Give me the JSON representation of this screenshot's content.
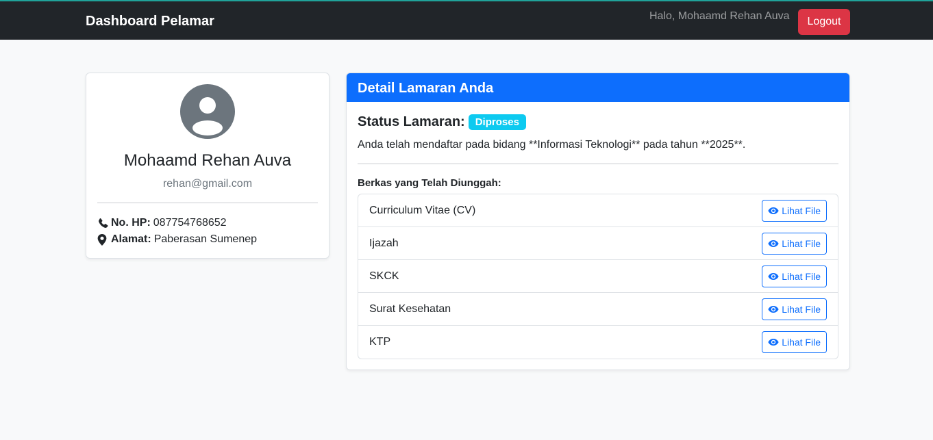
{
  "navbar": {
    "brand": "Dashboard Pelamar",
    "greeting": "Halo, Mohaamd Rehan Auva",
    "logout_label": "Logout"
  },
  "profile": {
    "avatar_icon": "user-circle-icon",
    "name": "Mohaamd Rehan Auva",
    "email": "rehan@gmail.com",
    "phone_label": "No. HP:",
    "phone": "087754768652",
    "address_label": "Alamat:",
    "address": "Paberasan Sumenep"
  },
  "detail": {
    "header": "Detail Lamaran Anda",
    "status_label": "Status Lamaran:",
    "status_value": "Diproses",
    "description": "Anda telah mendaftar pada bidang **Informasi Teknologi** pada tahun **2025**.",
    "files_heading": "Berkas yang Telah Diunggah:",
    "files": [
      {
        "name": "Curriculum Vitae (CV)",
        "button": "Lihat File"
      },
      {
        "name": "Ijazah",
        "button": "Lihat File"
      },
      {
        "name": "SKCK",
        "button": "Lihat File"
      },
      {
        "name": "Surat Kesehatan",
        "button": "Lihat File"
      },
      {
        "name": "KTP",
        "button": "Lihat File"
      }
    ]
  },
  "colors": {
    "navbar_bg": "#212529",
    "primary": "#0d6efd",
    "danger": "#dc3545",
    "info": "#0dcaf0",
    "muted": "#6c757d"
  }
}
